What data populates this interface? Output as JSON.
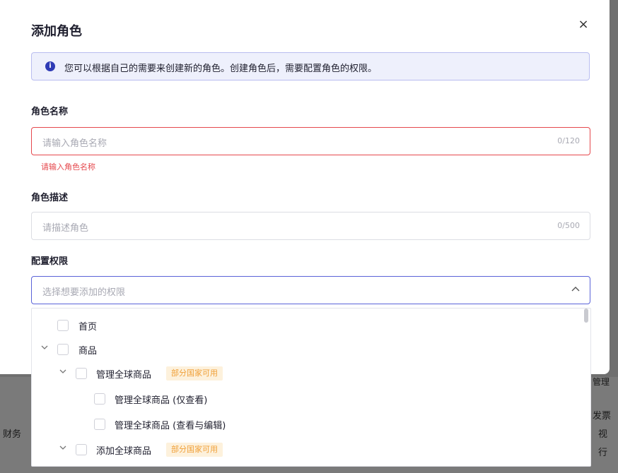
{
  "background": {
    "texts": [
      "财务",
      "发票",
      "视",
      "行",
      "管理"
    ]
  },
  "modal": {
    "title": "添加角色",
    "close_icon": "×",
    "info": {
      "icon": "i",
      "text": "您可以根据自己的需要来创建新的角色。创建角色后，需要配置角色的权限。"
    },
    "role_name": {
      "label": "角色名称",
      "placeholder": "请输入角色名称",
      "value": "",
      "counter": "0/120",
      "error": "请输入角色名称"
    },
    "role_desc": {
      "label": "角色描述",
      "placeholder": "请描述角色",
      "value": "",
      "counter": "0/500"
    },
    "permissions": {
      "label": "配置权限",
      "placeholder": "选择想要添加的权限",
      "chevron": "^",
      "tree": [
        {
          "label": "首页",
          "expandable": false,
          "checked": false
        },
        {
          "label": "商品",
          "expandable": true,
          "expanded": true,
          "checked": false
        },
        {
          "label": "管理全球商品",
          "expandable": true,
          "expanded": true,
          "checked": false,
          "tag": "部分国家可用"
        },
        {
          "label": "管理全球商品 (仅查看)",
          "expandable": false,
          "checked": false
        },
        {
          "label": "管理全球商品 (查看与编辑)",
          "expandable": false,
          "checked": false
        },
        {
          "label": "添加全球商品",
          "expandable": true,
          "expanded": true,
          "checked": false,
          "tag": "部分国家可用"
        }
      ]
    }
  },
  "colors": {
    "accent": "#5a63d8",
    "error": "#e5484d",
    "info_bg": "#eef0fc",
    "tag_bg": "#fdf1dc",
    "tag_text": "#f0a038"
  }
}
